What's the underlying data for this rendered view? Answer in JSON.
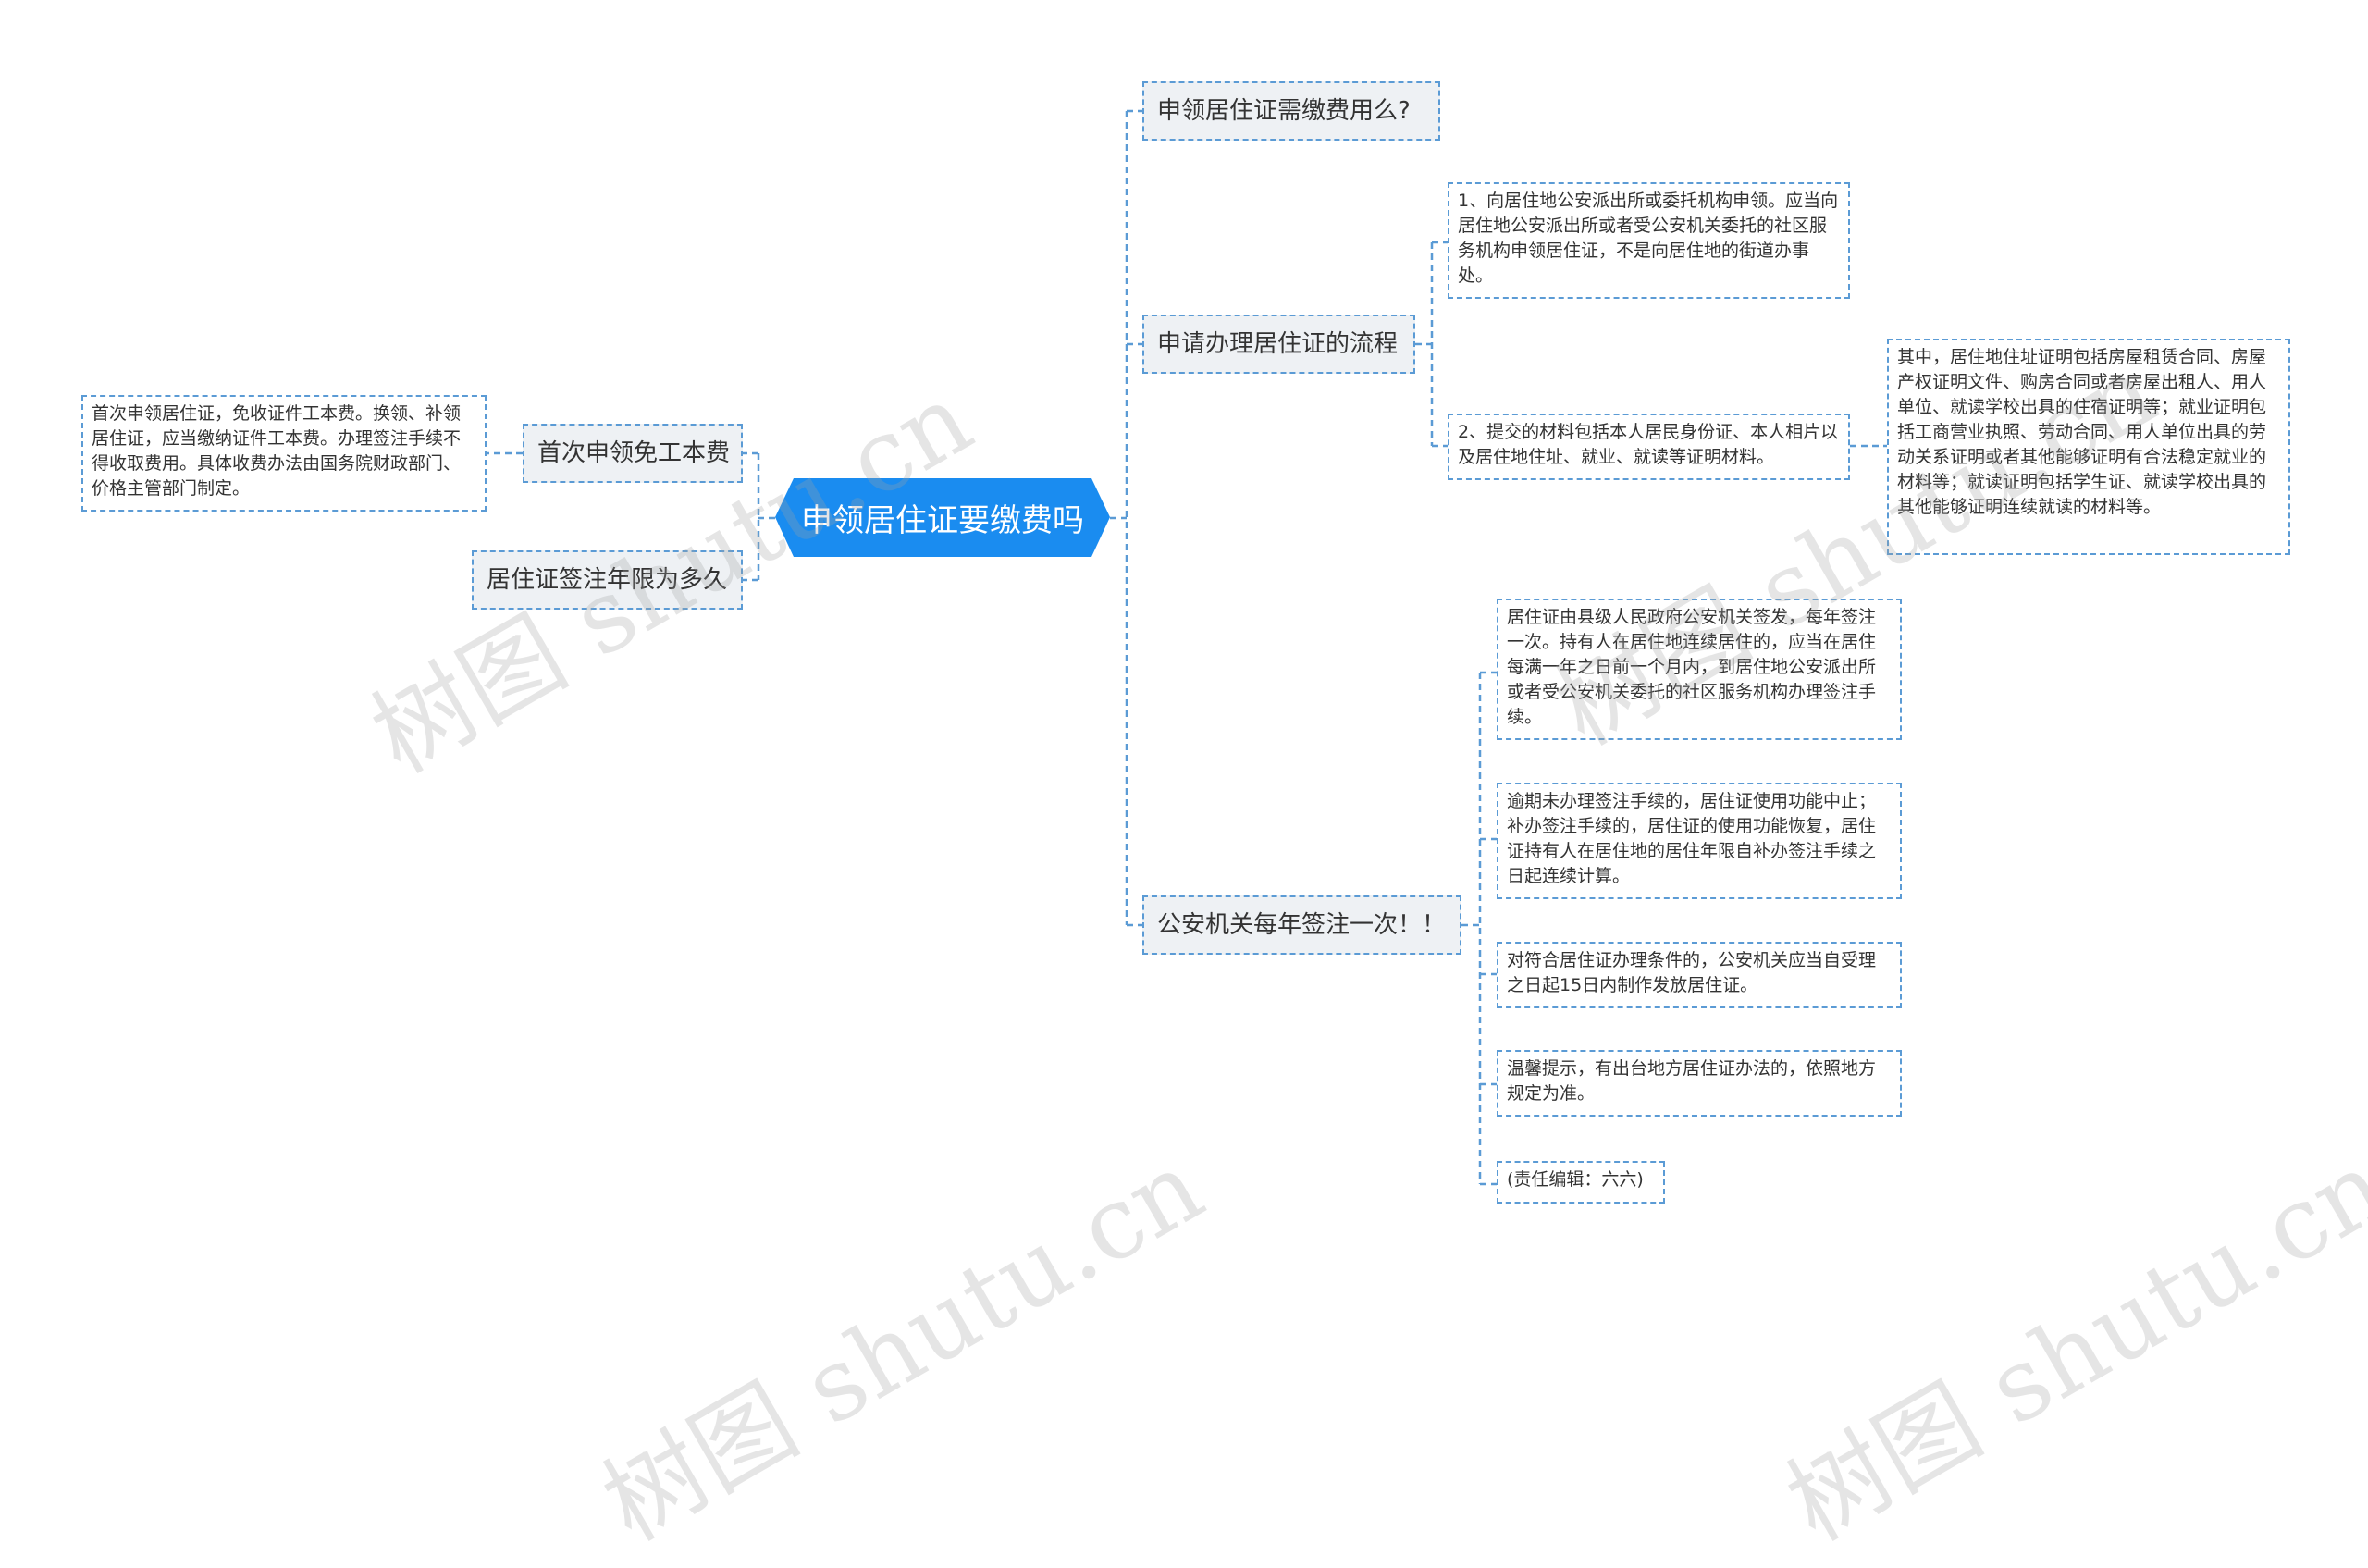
{
  "root": {
    "title": "申领居住证要缴费吗"
  },
  "left": {
    "fee": {
      "label": "首次申领免工本费",
      "detail": "首次申领居住证，免收证件工本费。换领、补领居住证，应当缴纳证件工本费。办理签注手续不得收取费用。具体收费办法由国务院财政部门、价格主管部门制定。"
    },
    "term": {
      "label": "居住证签注年限为多久"
    }
  },
  "right": {
    "q1": {
      "label": "申领居住证需缴费用么?"
    },
    "process": {
      "label": "申请办理居住证的流程",
      "step1": "1、向居住地公安派出所或委托机构申领。应当向居住地公安派出所或者受公安机关委托的社区服务机构申领居住证，不是向居住地的街道办事处。",
      "step2": "2、提交的材料包括本人居民身份证、本人相片以及居住地住址、就业、就读等证明材料。",
      "step2_detail": "其中，居住地住址证明包括房屋租赁合同、房屋产权证明文件、购房合同或者房屋出租人、用人单位、就读学校出具的住宿证明等；就业证明包括工商营业执照、劳动合同、用人单位出具的劳动关系证明或者其他能够证明有合法稳定就业的材料等；就读证明包括学生证、就读学校出具的其他能够证明连续就读的材料等。"
    },
    "annual": {
      "label": "公安机关每年签注一次！！",
      "items": [
        "居住证由县级人民政府公安机关签发，每年签注一次。持有人在居住地连续居住的，应当在居住每满一年之日前一个月内，到居住地公安派出所或者受公安机关委托的社区服务机构办理签注手续。",
        "逾期未办理签注手续的，居住证使用功能中止；补办签注手续的，居住证的使用功能恢复，居住证持有人在居住地的居住年限自补办签注手续之日起连续计算。",
        "对符合居住证办理条件的，公安机关应当自受理之日起15日内制作发放居住证。",
        "温馨提示，有出台地方居住证办法的，依照地方规定为准。",
        "(责任编辑：六六)"
      ]
    }
  },
  "watermark": {
    "text": "树图 shutu.cn"
  },
  "colors": {
    "root": "#1a8cf0",
    "line": "#5b9bd5",
    "branch_bg": "#eef1f4"
  }
}
